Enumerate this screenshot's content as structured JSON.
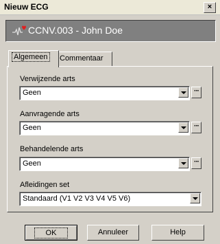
{
  "window": {
    "title": "Nieuw ECG",
    "close_label": "×"
  },
  "patient": {
    "text": "CCNV.003 - John Doe",
    "icon": "ecg-heart-icon"
  },
  "tabs": [
    {
      "label": "Algemeen",
      "active": true
    },
    {
      "label": "Commentaar",
      "active": false
    }
  ],
  "fields": [
    {
      "label": "Verwijzende arts",
      "value": "Geen",
      "has_browse": true
    },
    {
      "label": "Aanvragende arts",
      "value": "Geen",
      "has_browse": true
    },
    {
      "label": "Behandelende arts",
      "value": "Geen",
      "has_browse": true
    },
    {
      "label": "Afleidingen set",
      "value": "Standaard (V1 V2 V3 V4 V5 V6)",
      "has_browse": false
    }
  ],
  "browse_label": "···",
  "buttons": {
    "ok": "OK",
    "cancel": "Annuleer",
    "help": "Help"
  },
  "colors": {
    "banner_bg": "#808080",
    "face": "#d4d0c8"
  }
}
